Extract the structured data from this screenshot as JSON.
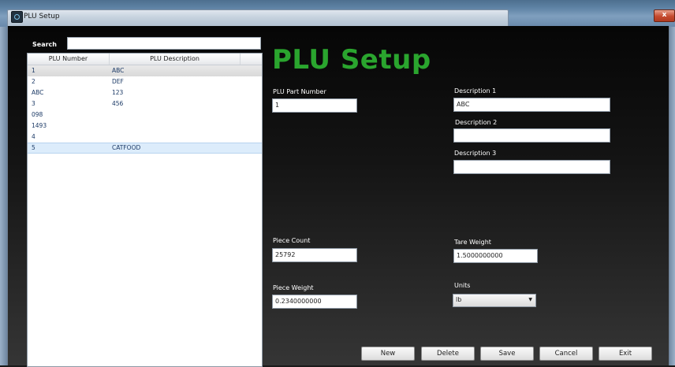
{
  "window": {
    "title": "PLU Setup",
    "close_label": "x"
  },
  "search": {
    "label": "Search",
    "value": "",
    "placeholder": ""
  },
  "list": {
    "columns": [
      "PLU Number",
      "PLU Description"
    ],
    "rows": [
      {
        "number": "1",
        "description": "ABC"
      },
      {
        "number": "2",
        "description": "DEF"
      },
      {
        "number": "ABC",
        "description": "123"
      },
      {
        "number": "3",
        "description": "456"
      },
      {
        "number": "098",
        "description": ""
      },
      {
        "number": "1493",
        "description": ""
      },
      {
        "number": "4",
        "description": ""
      },
      {
        "number": "5",
        "description": "CATFOOD"
      }
    ]
  },
  "main": {
    "title": "PLU Setup",
    "plu_part_number": {
      "label": "PLU Part Number",
      "value": "1"
    },
    "description1": {
      "label": "Description 1",
      "value": "ABC"
    },
    "description2": {
      "label": "Description 2",
      "value": ""
    },
    "description3": {
      "label": "Description 3",
      "value": ""
    },
    "piece_count": {
      "label": "Piece Count",
      "value": "25792"
    },
    "tare_weight": {
      "label": "Tare Weight",
      "value": "1.5000000000"
    },
    "piece_weight": {
      "label": "Piece Weight",
      "value": "0.2340000000"
    },
    "units": {
      "label": "Units",
      "value": "lb"
    }
  },
  "buttons": {
    "new": "New",
    "delete": "Delete",
    "save": "Save",
    "cancel": "Cancel",
    "exit": "Exit"
  },
  "colors": {
    "title_green": "#2aa52e",
    "window_blue": "#5f83a5",
    "close_red": "#c54a2f"
  }
}
